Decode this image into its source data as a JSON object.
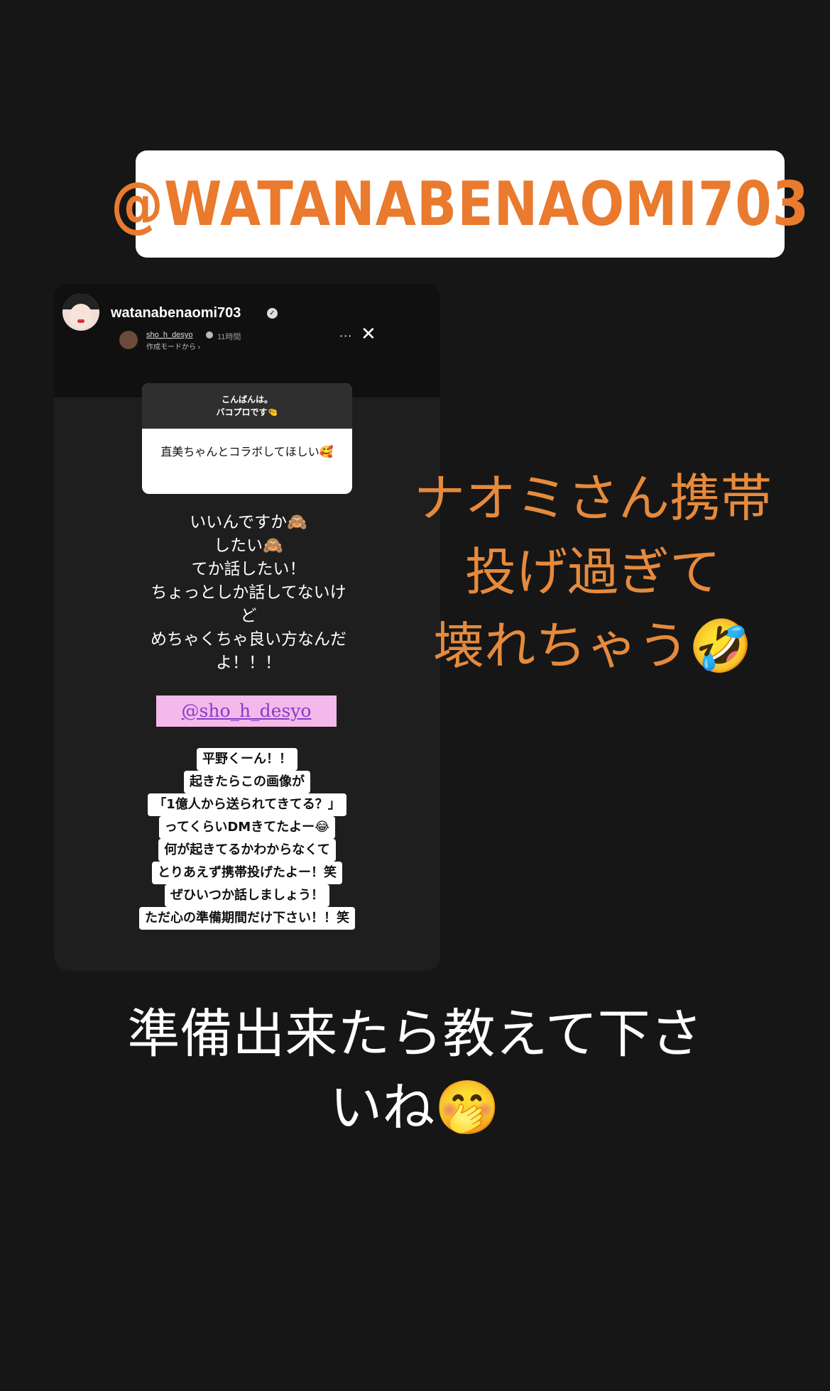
{
  "mention_sticker": {
    "text": "@WATANABENAOMI703"
  },
  "card": {
    "username": "watanabenaomi703",
    "sub_user": "sho_h_desyo",
    "time_ago": "11時間",
    "sub_label": "作成モードから ›",
    "more": "···",
    "close": "✕",
    "question_header_line1": "こんばんは。",
    "question_header_line2": "バコプロです🤏",
    "question_body": "直美ちゃんとコラボしてほしい🥰",
    "reply_lines": [
      "いいんですか🙈",
      "したい🙈",
      "てか話したい！",
      "ちょっとしか話してないけ",
      "ど",
      "めちゃくちゃ良い方なんだ",
      "よ！！！"
    ],
    "mention_tag": "@sho_h_desyo",
    "dm_lines": [
      "平野くーん！！",
      "起きたらこの画像が",
      "「1億人から送られてきてる？」",
      "ってくらいDMきてたよー😂",
      "何が起きてるかわからなくて",
      "とりあえず携帯投げたよー！笑",
      "ぜひいつか話しましょう！",
      "ただ心の準備期間だけ下さい！！笑"
    ]
  },
  "overlay_orange": {
    "line1": "ナオミさん携帯",
    "line2": "投げ過ぎて",
    "line3": "壊れちゃう🤣"
  },
  "overlay_white": {
    "line1": "準備出来たら教えて下さ",
    "line2": "いね🤭"
  }
}
